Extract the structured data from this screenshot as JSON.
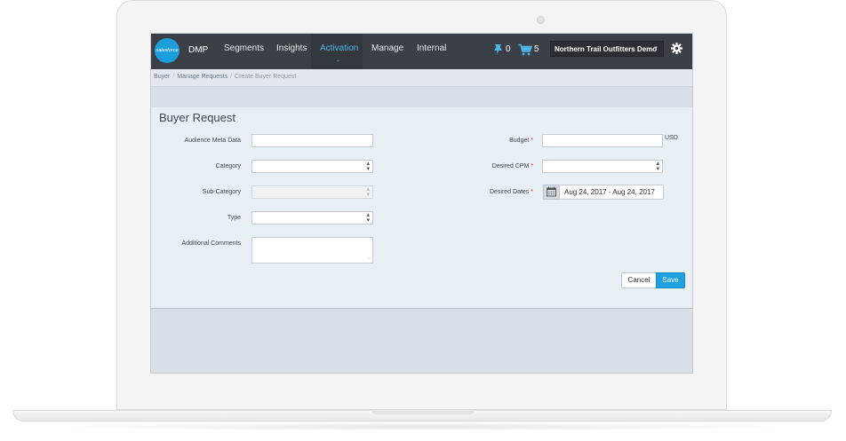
{
  "app": {
    "logo_text": "salesforce",
    "name": "DMP"
  },
  "nav": {
    "items": [
      {
        "label": "Segments"
      },
      {
        "label": "Insights"
      },
      {
        "label": "Activation",
        "active": true
      },
      {
        "label": "Manage"
      },
      {
        "label": "Internal"
      }
    ],
    "pins_count": "0",
    "cart_count": "5",
    "org_selected": "Northern Trail Outfitters Demo"
  },
  "breadcrumb": {
    "items": [
      "Buyer",
      "Manage Requests",
      "Create Buyer Request"
    ]
  },
  "form": {
    "title": "Buyer Request",
    "audience_meta_data": {
      "label": "Audience Meta Data",
      "value": ""
    },
    "category": {
      "label": "Category",
      "value": ""
    },
    "sub_category": {
      "label": "Sub-Category",
      "value": ""
    },
    "type": {
      "label": "Type",
      "value": ""
    },
    "additional_comments": {
      "label": "Additional Comments",
      "value": ""
    },
    "budget": {
      "label": "Budget",
      "value": "",
      "unit": "USD",
      "required_mark": "*"
    },
    "desired_cpm": {
      "label": "Desired CPM",
      "value": "",
      "required_mark": "*"
    },
    "desired_dates": {
      "label": "Desired Dates",
      "value": "Aug 24, 2017 - Aug 24, 2017",
      "required_mark": "*"
    }
  },
  "actions": {
    "cancel_label": "Cancel",
    "save_label": "Save"
  },
  "colors": {
    "navbar": "#3b4047",
    "accent": "#1fa0e0",
    "active_nav": "#4fb6e8",
    "required": "#d52a2a"
  }
}
